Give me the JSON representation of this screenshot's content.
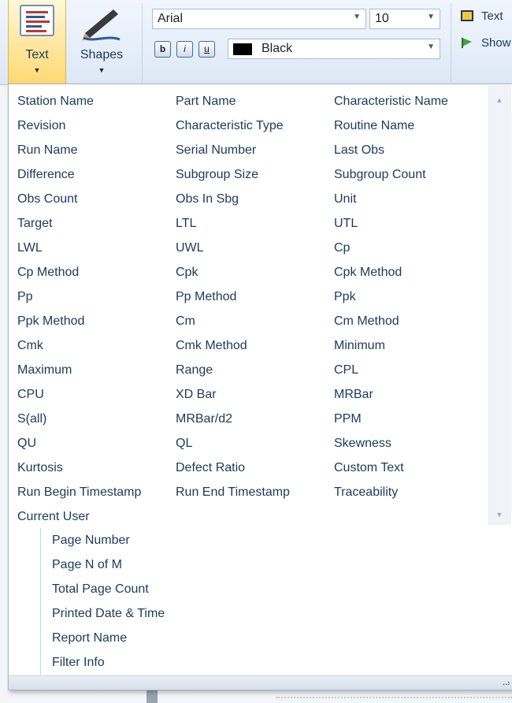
{
  "ribbon": {
    "text_button_label": "Text",
    "shapes_button_label": "Shapes",
    "font_family": "Arial",
    "font_size": "10",
    "bold_glyph": "b",
    "italic_glyph": "i",
    "underline_glyph": "u",
    "font_color": "Black",
    "font_color_hex": "#000000",
    "right_items": [
      "Text",
      "Show"
    ]
  },
  "menu": {
    "columns": [
      [
        "Station Name",
        "Revision",
        "Run Name",
        "Difference",
        "Obs Count",
        "Target",
        "LWL",
        "Cp Method",
        "Pp",
        "Ppk Method",
        "Cmk",
        "Maximum",
        "CPU",
        "S(all)",
        "QU",
        "Kurtosis",
        "Run Begin Timestamp",
        "Current User"
      ],
      [
        "Part Name",
        "Characteristic Type",
        "Serial Number",
        "Subgroup Size",
        "Obs In Sbg",
        "LTL",
        "UWL",
        "Cpk",
        "Pp Method",
        "Cm",
        "Cmk Method",
        "Range",
        "XD Bar",
        "MRBar/d2",
        "QL",
        "Defect Ratio",
        "Run End Timestamp"
      ],
      [
        "Characteristic Name",
        "Routine Name",
        "Last Obs",
        "Subgroup Count",
        "Unit",
        "UTL",
        "Cp",
        "Cpk Method",
        "Ppk",
        "Cm Method",
        "Minimum",
        "CPL",
        "MRBar",
        "PPM",
        "Skewness",
        "Custom Text",
        "Traceability"
      ]
    ],
    "system_items": [
      "Page Number",
      "Page N of M",
      "Total Page Count",
      "Printed Date & Time",
      "Report Name",
      "Filter Info"
    ]
  },
  "colors": {
    "text": "#1e395b",
    "active_button": "#ffd870"
  }
}
